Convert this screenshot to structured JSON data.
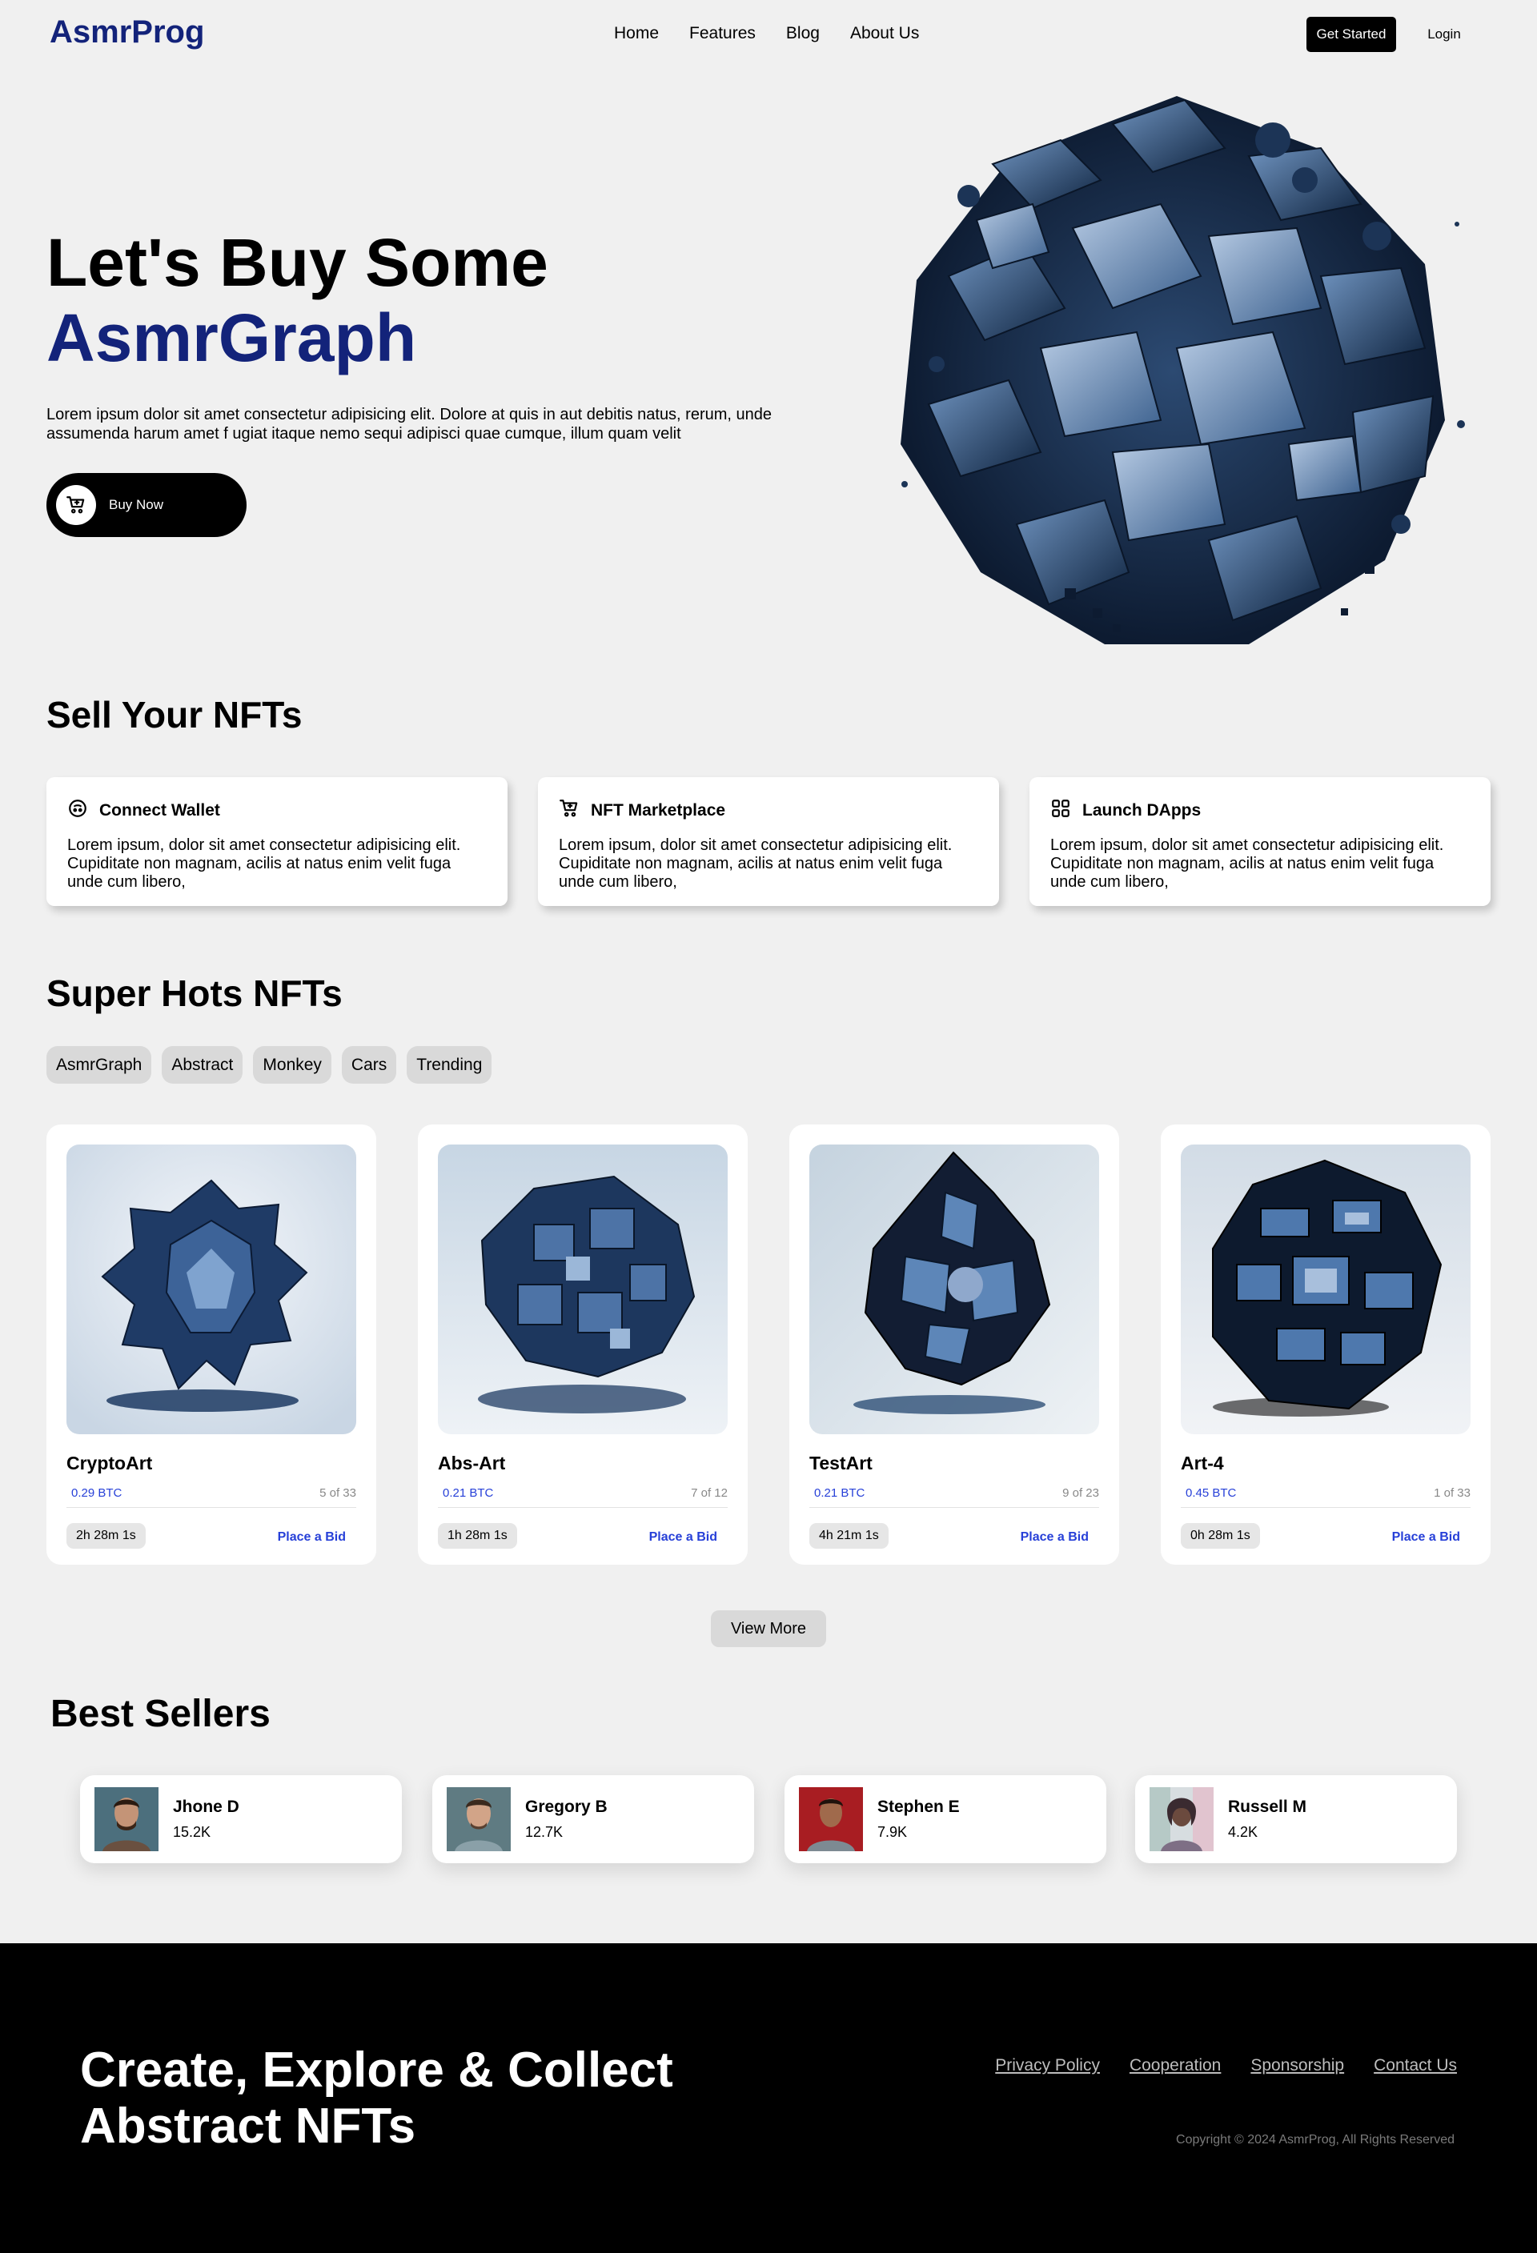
{
  "header": {
    "logo": "AsmrProg",
    "nav": [
      "Home",
      "Features",
      "Blog",
      "About Us"
    ],
    "get_started": "Get Started",
    "login": "Login"
  },
  "hero": {
    "title_line1": "Let's Buy Some",
    "title_line2": "AsmrGraph",
    "description": "Lorem ipsum dolor sit amet consectetur adipisicing elit. Dolore at quis in aut debitis natus, rerum, unde assumenda harum amet f ugiat itaque nemo sequi adipisci quae cumque, illum quam velit",
    "buy_label": "Buy Now"
  },
  "sell": {
    "title": "Sell Your NFTs",
    "cards": [
      {
        "icon": "wallet-icon",
        "title": "Connect Wallet",
        "text": "Lorem ipsum, dolor sit amet consectetur adipisicing elit. Cupiditate non magnam, acilis at natus enim velit fuga unde cum libero,"
      },
      {
        "icon": "cart-icon",
        "title": "NFT Marketplace",
        "text": "Lorem ipsum, dolor sit amet consectetur adipisicing elit. Cupiditate non magnam, acilis at natus enim velit fuga unde cum libero,"
      },
      {
        "icon": "grid-icon",
        "title": "Launch DApps",
        "text": "Lorem ipsum, dolor sit amet consectetur adipisicing elit. Cupiditate non magnam, acilis at natus enim velit fuga unde cum libero,"
      }
    ]
  },
  "hots": {
    "title": "Super Hots NFTs",
    "filters": [
      "AsmrGraph",
      "Abstract",
      "Monkey",
      "Cars",
      "Trending"
    ],
    "cards": [
      {
        "name": "CryptoArt",
        "price": "0.29 BTC",
        "edition": "5 of 33",
        "time": "2h 28m 1s",
        "bid": "Place a Bid"
      },
      {
        "name": "Abs-Art",
        "price": "0.21 BTC",
        "edition": "7 of 12",
        "time": "1h 28m 1s",
        "bid": "Place a Bid"
      },
      {
        "name": "TestArt",
        "price": "0.21 BTC",
        "edition": "9 of 23",
        "time": "4h 21m 1s",
        "bid": "Place a Bid"
      },
      {
        "name": "Art-4",
        "price": "0.45 BTC",
        "edition": "1 of 33",
        "time": "0h 28m 1s",
        "bid": "Place a Bid"
      }
    ],
    "view_more": "View More"
  },
  "sellers": {
    "title": "Best Sellers",
    "items": [
      {
        "name": "Jhone D",
        "count": "15.2K"
      },
      {
        "name": "Gregory B",
        "count": "12.7K"
      },
      {
        "name": "Stephen E",
        "count": "7.9K"
      },
      {
        "name": "Russell M",
        "count": "4.2K"
      }
    ]
  },
  "footer": {
    "title": "Create, Explore & Collect Abstract NFTs",
    "links": [
      "Privacy Policy",
      "Cooperation",
      "Sponsorship",
      "Contact Us"
    ],
    "copyright": "Copyright © 2024 AsmrProg, All Rights Reserved"
  },
  "colors": {
    "brand": "#13237a",
    "accent_blue": "#2740d8",
    "background": "#f0f0f0",
    "footer_bg": "#000000"
  }
}
